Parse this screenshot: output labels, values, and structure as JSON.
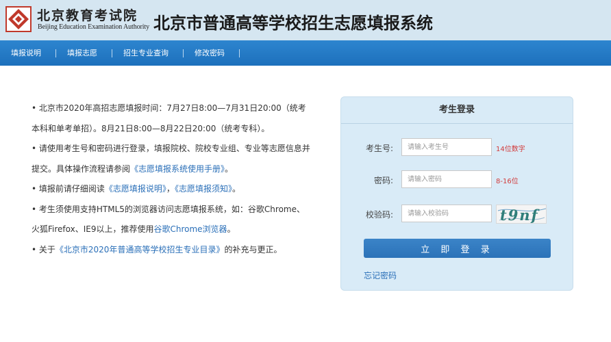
{
  "header": {
    "logo_cn": "北京教育考试院",
    "logo_en": "Beijing Education Examination Authority",
    "site_title": "北京市普通高等学校招生志愿填报系统"
  },
  "nav": {
    "items": [
      "填报说明",
      "填报志愿",
      "招生专业查询",
      "修改密码"
    ]
  },
  "notices": {
    "n1": "• 北京市2020年高招志愿填报时间：7月27日8:00—7月31日20:00（统考本科和单考单招）。8月21日8:00—8月22日20:00（统考专科）。",
    "n2_pre": "• 请使用考生号和密码进行登录，填报院校、院校专业组、专业等志愿信息并提交。具体操作流程请参阅",
    "n2_link": "《志愿填报系统使用手册》",
    "n2_post": "。",
    "n3_pre": "• 填报前请仔细阅读",
    "n3_link1": "《志愿填报说明》",
    "n3_sep": "，",
    "n3_link2": "《志愿填报须知》",
    "n3_post": "。",
    "n4_pre": "• 考生须使用支持HTML5的浏览器访问志愿填报系统，如：谷歌Chrome、火狐Firefox、IE9以上，推荐使用",
    "n4_link": "谷歌Chrome浏览器",
    "n4_post": "。",
    "n5_pre": "• 关于",
    "n5_link": "《北京市2020年普通高等学校招生专业目录》",
    "n5_post": "的补充与更正。"
  },
  "login": {
    "title": "考生登录",
    "id_label": "考生号:",
    "id_placeholder": "请输入考生号",
    "id_hint": "14位数字",
    "pwd_label": "密码:",
    "pwd_placeholder": "请输入密码",
    "pwd_hint": "8-16位",
    "captcha_label": "校验码:",
    "captcha_placeholder": "请输入校验码",
    "captcha_text": "t9nf",
    "submit_label": "立 即 登 录",
    "forgot_label": "忘记密码"
  },
  "colors": {
    "header_bg": "#d5e6f1",
    "nav_bg": "#1d70bc",
    "link": "#2a6fb8",
    "hint_red": "#d23b3b",
    "panel_bg": "#d9ebf7"
  }
}
